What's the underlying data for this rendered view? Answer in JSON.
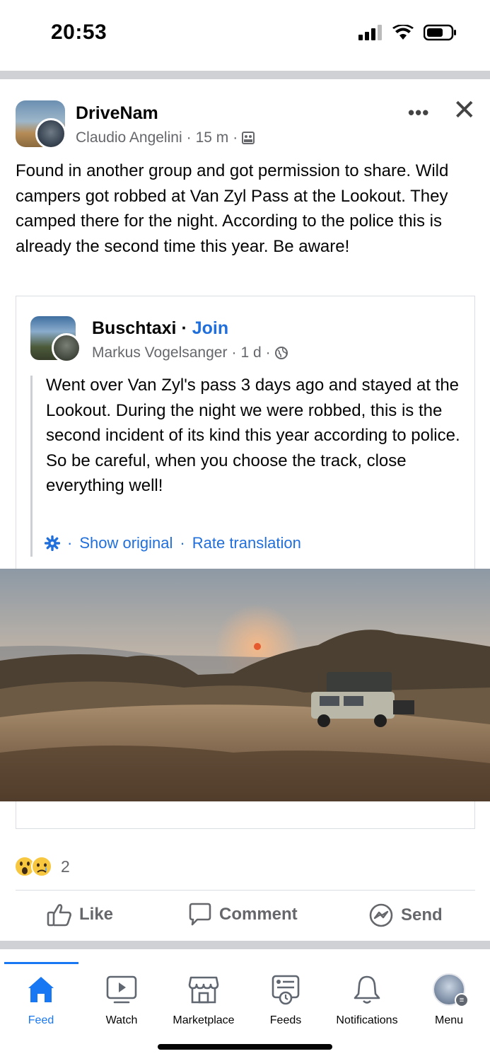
{
  "status": {
    "time": "20:53"
  },
  "post": {
    "group_name": "DriveNam",
    "author": "Claudio Angelini",
    "time": "15 m",
    "separator": "·",
    "text": "Found in another group and got permission to share. Wild campers got robbed at Van Zyl Pass at the Lookout. They camped there for the night. According to the police this is already the second time this year. Be aware!"
  },
  "shared": {
    "group_name": "Buschtaxi",
    "join_label": "Join",
    "author": "Markus Vogelsanger",
    "time": "1 d",
    "text": "Went over Van Zyl's pass 3 days ago and stayed at the Lookout. During the night we were robbed, this is the second incident of its kind this year according to police. So be careful, when you choose the track, close everything well!",
    "show_original": "Show original",
    "rate_translation": "Rate translation"
  },
  "reactions": {
    "count": "2",
    "emojis": [
      "shocked-emoji",
      "sad-emoji"
    ]
  },
  "actions": {
    "like": "Like",
    "comment": "Comment",
    "send": "Send"
  },
  "nav": {
    "feed": "Feed",
    "watch": "Watch",
    "marketplace": "Marketplace",
    "feeds": "Feeds",
    "notifications": "Notifications",
    "menu": "Menu"
  },
  "colors": {
    "accent": "#1877f2",
    "link": "#216fdb",
    "muted": "#65676b"
  }
}
